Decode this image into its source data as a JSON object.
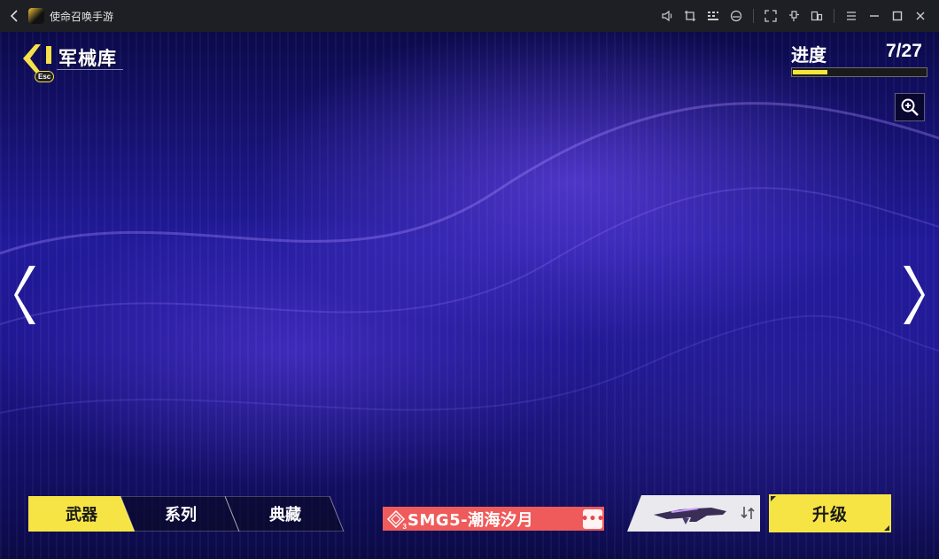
{
  "titlebar": {
    "title": "使命召唤手游",
    "icons": [
      "volume-icon",
      "crop-icon",
      "keyboard-icon",
      "gamepad-icon",
      "fullscreen-icon",
      "pin-icon",
      "multi-window-icon",
      "menu-icon",
      "minimize-icon",
      "maximize-icon",
      "close-icon"
    ]
  },
  "header": {
    "title": "军械库",
    "esc_label": "Esc"
  },
  "progress": {
    "label": "进度",
    "value": "7/27",
    "current": 7,
    "total": 27
  },
  "tabs": [
    {
      "label": "武器",
      "active": true
    },
    {
      "label": "系列",
      "active": false
    },
    {
      "label": "典藏",
      "active": false
    }
  ],
  "weapon": {
    "name": "SMG5-潮海汐月",
    "tier": "3",
    "more_label": "•••"
  },
  "upgrade_label": "升级",
  "colors": {
    "accent_yellow": "#f6e445",
    "weapon_bar_red": "#ef5b5b",
    "bg_purple": "#211a9a"
  }
}
